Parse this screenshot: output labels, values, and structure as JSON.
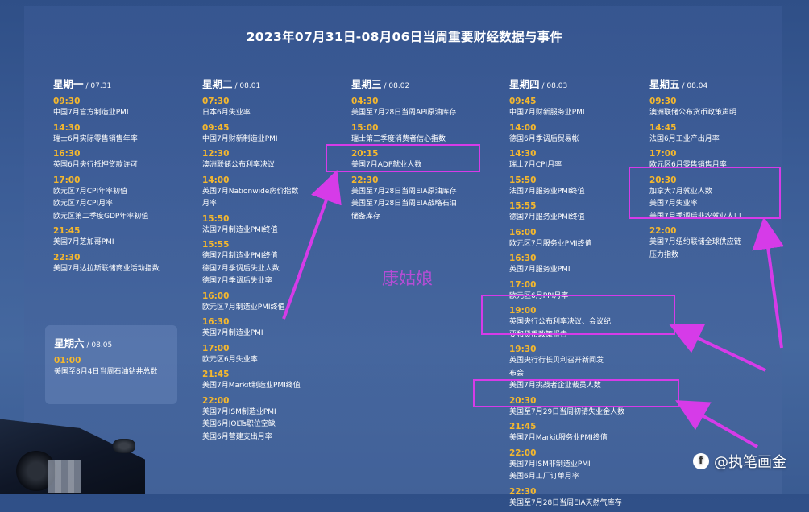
{
  "title": "2023年07月31日-08月06日当周重要财经数据与事件",
  "days": [
    {
      "name": "星期一",
      "date": "/ 07.31",
      "events": [
        {
          "time": "09:30",
          "items": [
            "中国7月官方制造业PMI"
          ]
        },
        {
          "time": "14:30",
          "items": [
            "瑞士6月实际零售销售年率"
          ]
        },
        {
          "time": "16:30",
          "items": [
            "英国6月央行抵押贷款许可"
          ]
        },
        {
          "time": "17:00",
          "items": [
            "欧元区7月CPI年率初值",
            "欧元区7月CPI月率",
            "欧元区第二季度GDP年率初值"
          ]
        },
        {
          "time": "21:45",
          "items": [
            "美国7月芝加哥PMI"
          ]
        },
        {
          "time": "22:30",
          "items": [
            "美国7月达拉斯联储商业活动指数"
          ]
        }
      ]
    },
    {
      "name": "星期二",
      "date": "/ 08.01",
      "events": [
        {
          "time": "07:30",
          "items": [
            "日本6月失业率"
          ]
        },
        {
          "time": "09:45",
          "items": [
            "中国7月财新制造业PMI"
          ]
        },
        {
          "time": "12:30",
          "items": [
            "澳洲联储公布利率决议"
          ]
        },
        {
          "time": "14:00",
          "items": [
            "英国7月Nationwide房价指数",
            "月率"
          ]
        },
        {
          "time": "15:50",
          "items": [
            "法国7月制造业PMI终值"
          ]
        },
        {
          "time": "15:55",
          "items": [
            "德国7月制造业PMI终值",
            "德国7月季调后失业人数",
            "德国7月季调后失业率"
          ]
        },
        {
          "time": "16:00",
          "items": [
            "欧元区7月制造业PMI终值"
          ]
        },
        {
          "time": "16:30",
          "items": [
            "英国7月制造业PMI"
          ]
        },
        {
          "time": "17:00",
          "items": [
            "欧元区6月失业率"
          ]
        },
        {
          "time": "21:45",
          "items": [
            "美国7月Markit制造业PMI终值"
          ]
        },
        {
          "time": "22:00",
          "items": [
            "美国7月ISM制造业PMI",
            "美国6月JOLTs职位空缺",
            "美国6月营建支出月率"
          ]
        }
      ]
    },
    {
      "name": "星期三",
      "date": "/ 08.02",
      "events": [
        {
          "time": "04:30",
          "items": [
            "美国至7月28日当周API原油库存"
          ]
        },
        {
          "time": "15:00",
          "items": [
            "瑞士第三季度消费者信心指数"
          ]
        },
        {
          "time": "20:15",
          "items": [
            "美国7月ADP就业人数"
          ]
        },
        {
          "time": "22:30",
          "items": [
            "美国至7月28日当周EIA原油库存",
            "美国至7月28日当周EIA战略石油",
            "储备库存"
          ]
        }
      ]
    },
    {
      "name": "星期四",
      "date": "/ 08.03",
      "events": [
        {
          "time": "09:45",
          "items": [
            "中国7月财新服务业PMI"
          ]
        },
        {
          "time": "14:00",
          "items": [
            "德国6月季调后贸易帐"
          ]
        },
        {
          "time": "14:30",
          "items": [
            "瑞士7月CPI月率"
          ]
        },
        {
          "time": "15:50",
          "items": [
            "法国7月服务业PMI终值"
          ]
        },
        {
          "time": "15:55",
          "items": [
            "德国7月服务业PMI终值"
          ]
        },
        {
          "time": "16:00",
          "items": [
            "欧元区7月服务业PMI终值"
          ]
        },
        {
          "time": "16:30",
          "items": [
            "英国7月服务业PMI"
          ]
        },
        {
          "time": "17:00",
          "items": [
            "欧元区6月PPI月率"
          ]
        },
        {
          "time": "19:00",
          "items": [
            "英国央行公布利率决议、会议纪",
            "要和货币政策报告"
          ]
        },
        {
          "time": "19:30",
          "items": [
            "英国央行行长贝利召开新闻发",
            "布会",
            "美国7月挑战者企业裁员人数"
          ]
        },
        {
          "time": "20:30",
          "items": [
            "美国至7月29日当周初请失业金人数"
          ]
        },
        {
          "time": "21:45",
          "items": [
            "美国7月Markit服务业PMI终值"
          ]
        },
        {
          "time": "22:00",
          "items": [
            "美国7月ISM非制造业PMI",
            "美国6月工厂订单月率"
          ]
        },
        {
          "time": "22:30",
          "items": [
            "美国至7月28日当周EIA天然气库存"
          ]
        }
      ]
    },
    {
      "name": "星期五",
      "date": "/ 08.04",
      "events": [
        {
          "time": "09:30",
          "items": [
            "澳洲联储公布货币政策声明"
          ]
        },
        {
          "time": "14:45",
          "items": [
            "法国6月工业产出月率"
          ]
        },
        {
          "time": "17:00",
          "items": [
            "欧元区6月零售销售月率"
          ]
        },
        {
          "time": "20:30",
          "items": [
            "加拿大7月就业人数",
            "美国7月失业率",
            "美国7月季调后非农就业人口"
          ]
        },
        {
          "time": "22:00",
          "items": [
            "美国7月纽约联储全球供应链",
            "压力指数"
          ]
        }
      ]
    }
  ],
  "saturday": {
    "name": "星期六",
    "date": "/ 08.05",
    "events": [
      {
        "time": "01:00",
        "items": [
          "美国至8月4日当周石油钻井总数"
        ]
      }
    ]
  },
  "watermark": "康姑娘",
  "brand": {
    "logo": "f",
    "text": "@执笔画金"
  },
  "colors": {
    "time": "#f5b82e",
    "highlight": "#d63be8",
    "text": "#ffffff"
  }
}
